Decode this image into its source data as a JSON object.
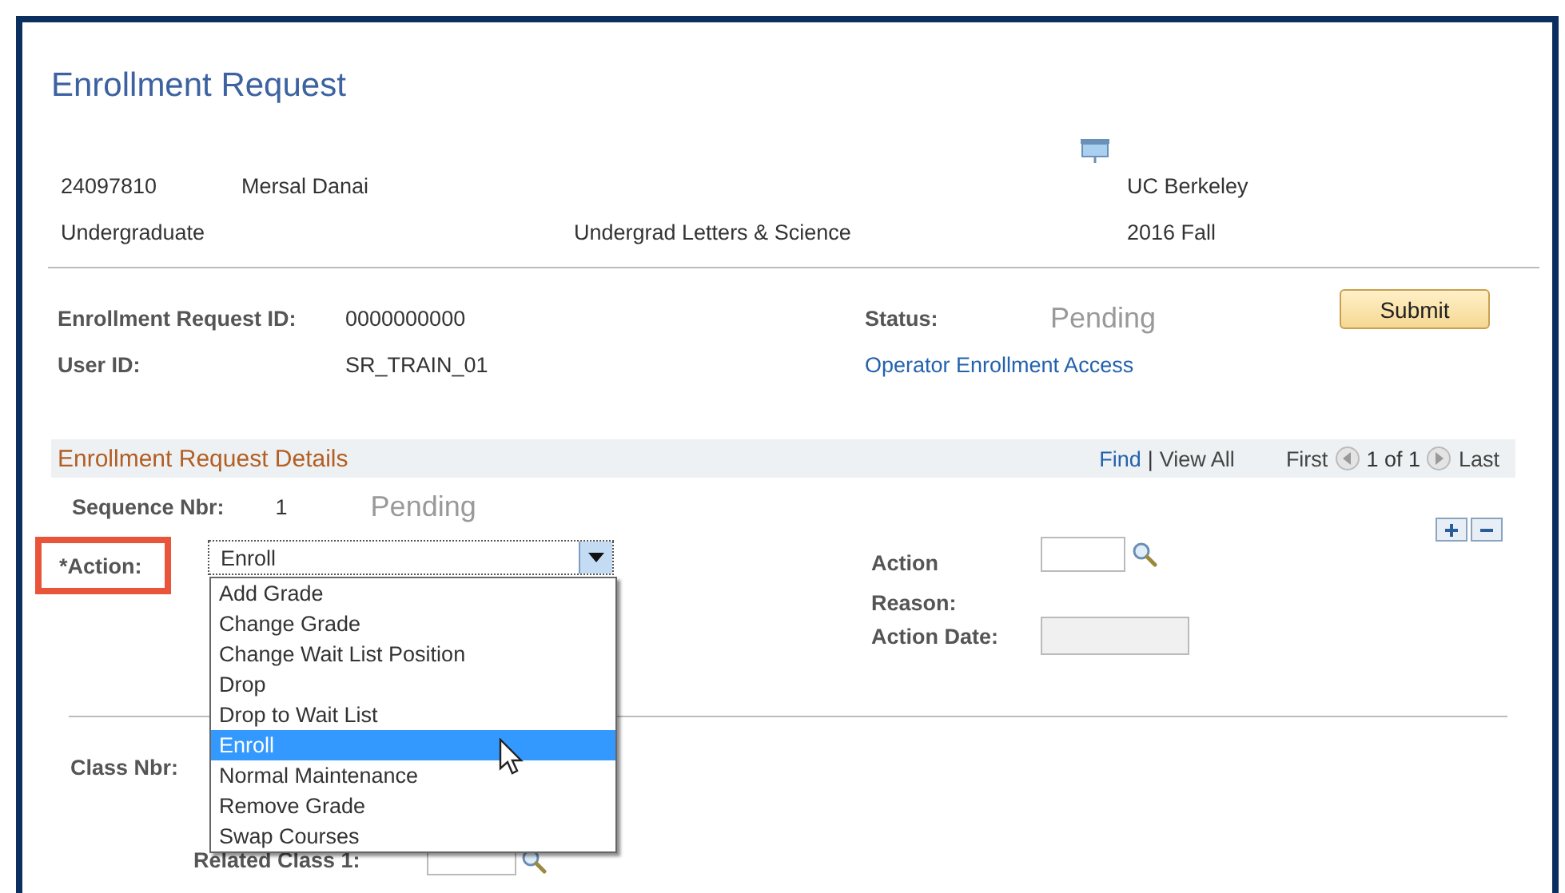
{
  "page_title": "Enrollment Request",
  "student": {
    "id": "24097810",
    "name": "Mersal Danai",
    "institution": "UC Berkeley",
    "career": "Undergraduate",
    "program": "Undergrad Letters & Science",
    "term": "2016 Fall"
  },
  "request": {
    "id_label": "Enrollment Request ID:",
    "id": "0000000000",
    "status_label": "Status:",
    "status": "Pending",
    "submit_button": "Submit",
    "user_label": "User ID:",
    "user": "SR_TRAIN_01",
    "access_link": "Operator Enrollment Access"
  },
  "details": {
    "title": "Enrollment Request Details",
    "find": "Find",
    "separator": "|",
    "view_all": "View All",
    "first": "First",
    "counter": "1 of 1",
    "last": "Last",
    "sequence_label": "Sequence Nbr:",
    "sequence": "1",
    "status": "Pending"
  },
  "action": {
    "label": "*Action:",
    "highlighted": true,
    "value": "Enroll",
    "expanded": true,
    "options": [
      {
        "label": "Add Grade",
        "selected": false
      },
      {
        "label": "Change Grade",
        "selected": false
      },
      {
        "label": "Change Wait List Position",
        "selected": false
      },
      {
        "label": "Drop",
        "selected": false
      },
      {
        "label": "Drop to Wait List",
        "selected": false
      },
      {
        "label": "Enroll",
        "selected": true
      },
      {
        "label": "Normal Maintenance",
        "selected": false
      },
      {
        "label": "Remove Grade",
        "selected": false
      },
      {
        "label": "Swap Courses",
        "selected": false
      }
    ]
  },
  "reason": {
    "label": "Action Reason:"
  },
  "action_date": {
    "label": "Action Date:",
    "disabled": true
  },
  "class": {
    "label": "Class Nbr:",
    "related_label": "Related Class 1:"
  }
}
